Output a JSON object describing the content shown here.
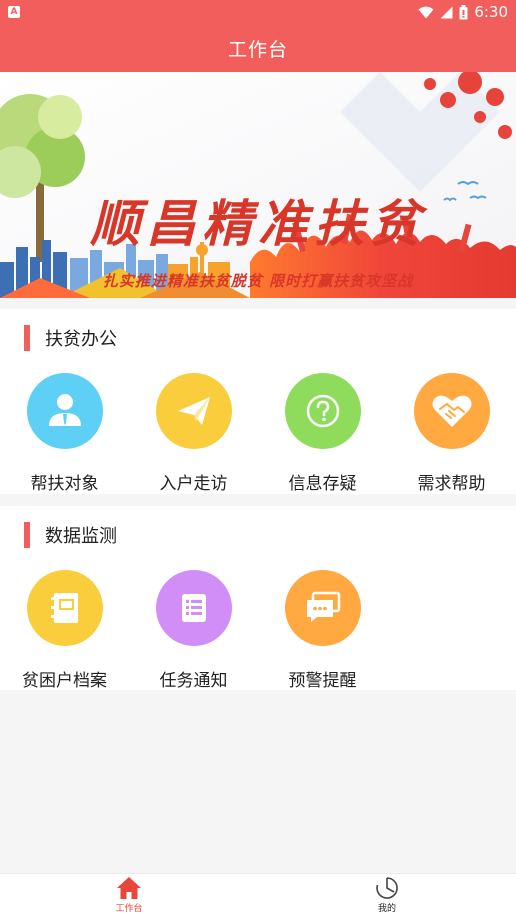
{
  "status_bar": {
    "notification_icon": "A",
    "time": "6:30",
    "icons": [
      "wifi-icon",
      "signal-icon",
      "battery-icon"
    ]
  },
  "app_bar": {
    "title": "工作台"
  },
  "banner": {
    "title": "顺昌精准扶贫",
    "subtitle": "扎实推进精准扶贫脱贫   限时打赢扶贫攻坚战"
  },
  "sections": [
    {
      "title": "扶贫办公",
      "items": [
        {
          "label": "帮扶对象",
          "icon": "person-icon",
          "color": "#5fd0f5"
        },
        {
          "label": "入户走访",
          "icon": "paper-plane-icon",
          "color": "#f9cd3c"
        },
        {
          "label": "信息存疑",
          "icon": "question-icon",
          "color": "#8fdc5d"
        },
        {
          "label": "需求帮助",
          "icon": "handshake-heart-icon",
          "color": "#ffa940"
        }
      ]
    },
    {
      "title": "数据监测",
      "items": [
        {
          "label": "贫困户档案",
          "icon": "notebook-icon",
          "color": "#f9cd3c"
        },
        {
          "label": "任务通知",
          "icon": "list-doc-icon",
          "color": "#d18ef7"
        },
        {
          "label": "预警提醒",
          "icon": "chat-bubble-icon",
          "color": "#ffa940"
        }
      ]
    }
  ],
  "bottom_nav": {
    "items": [
      {
        "label": "工作台",
        "icon": "home-icon",
        "active": true
      },
      {
        "label": "我的",
        "icon": "clock-icon",
        "active": false
      }
    ],
    "active_color": "#e8463b"
  },
  "colors": {
    "primary": "#f25e5b",
    "background": "#f5f5f5"
  }
}
